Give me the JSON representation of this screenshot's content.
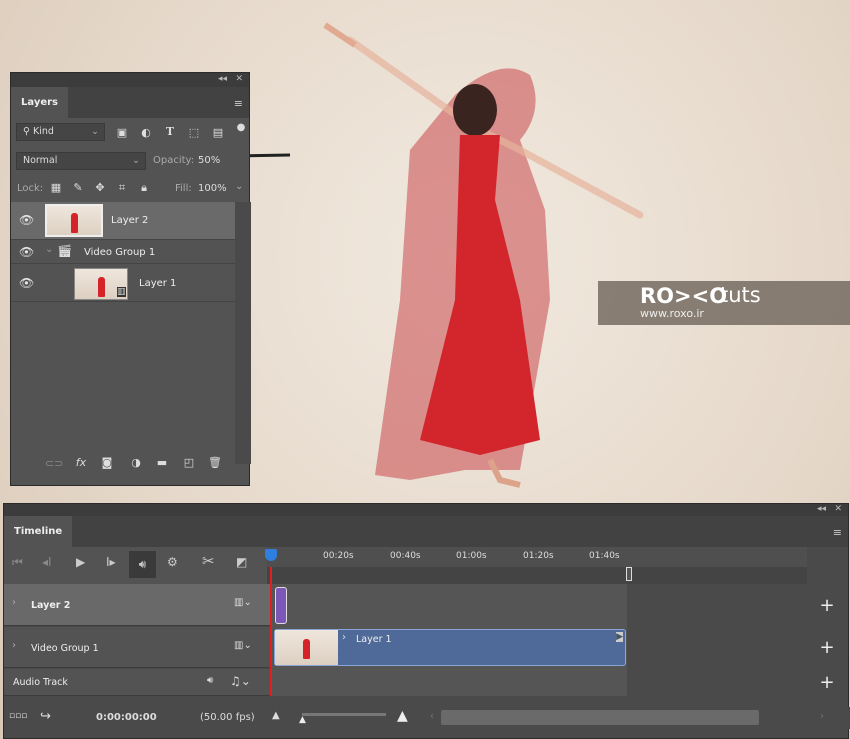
{
  "layers_panel": {
    "tab": "Layers",
    "filter_kind": "Kind",
    "blend_mode": "Normal",
    "opacity_label": "Opacity:",
    "opacity_value": "50%",
    "lock_label": "Lock:",
    "fill_label": "Fill:",
    "fill_value": "100%",
    "layers": [
      {
        "name": "Layer 2",
        "selected": true
      },
      {
        "name": "Video Group 1",
        "type": "video-group"
      },
      {
        "name": "Layer 1",
        "type": "video"
      }
    ]
  },
  "watermark": {
    "brand": "RO><O",
    "suffix": "tuts",
    "url": "www.roxo.ir"
  },
  "timeline": {
    "tab": "Timeline",
    "ruler": [
      "00:20s",
      "00:40s",
      "01:00s",
      "01:20s",
      "01:40s"
    ],
    "tracks": [
      {
        "name": "Layer 2"
      },
      {
        "name": "Video Group 1",
        "clip": "Layer 1"
      },
      {
        "name": "Audio Track"
      }
    ],
    "timecode": "0:00:00:00",
    "fps": "(50.00 fps)"
  },
  "colors": {
    "panel": "#535353",
    "clip": "#4f6a98",
    "clip_short": "#7c57b8",
    "playhead": "#e02020"
  }
}
